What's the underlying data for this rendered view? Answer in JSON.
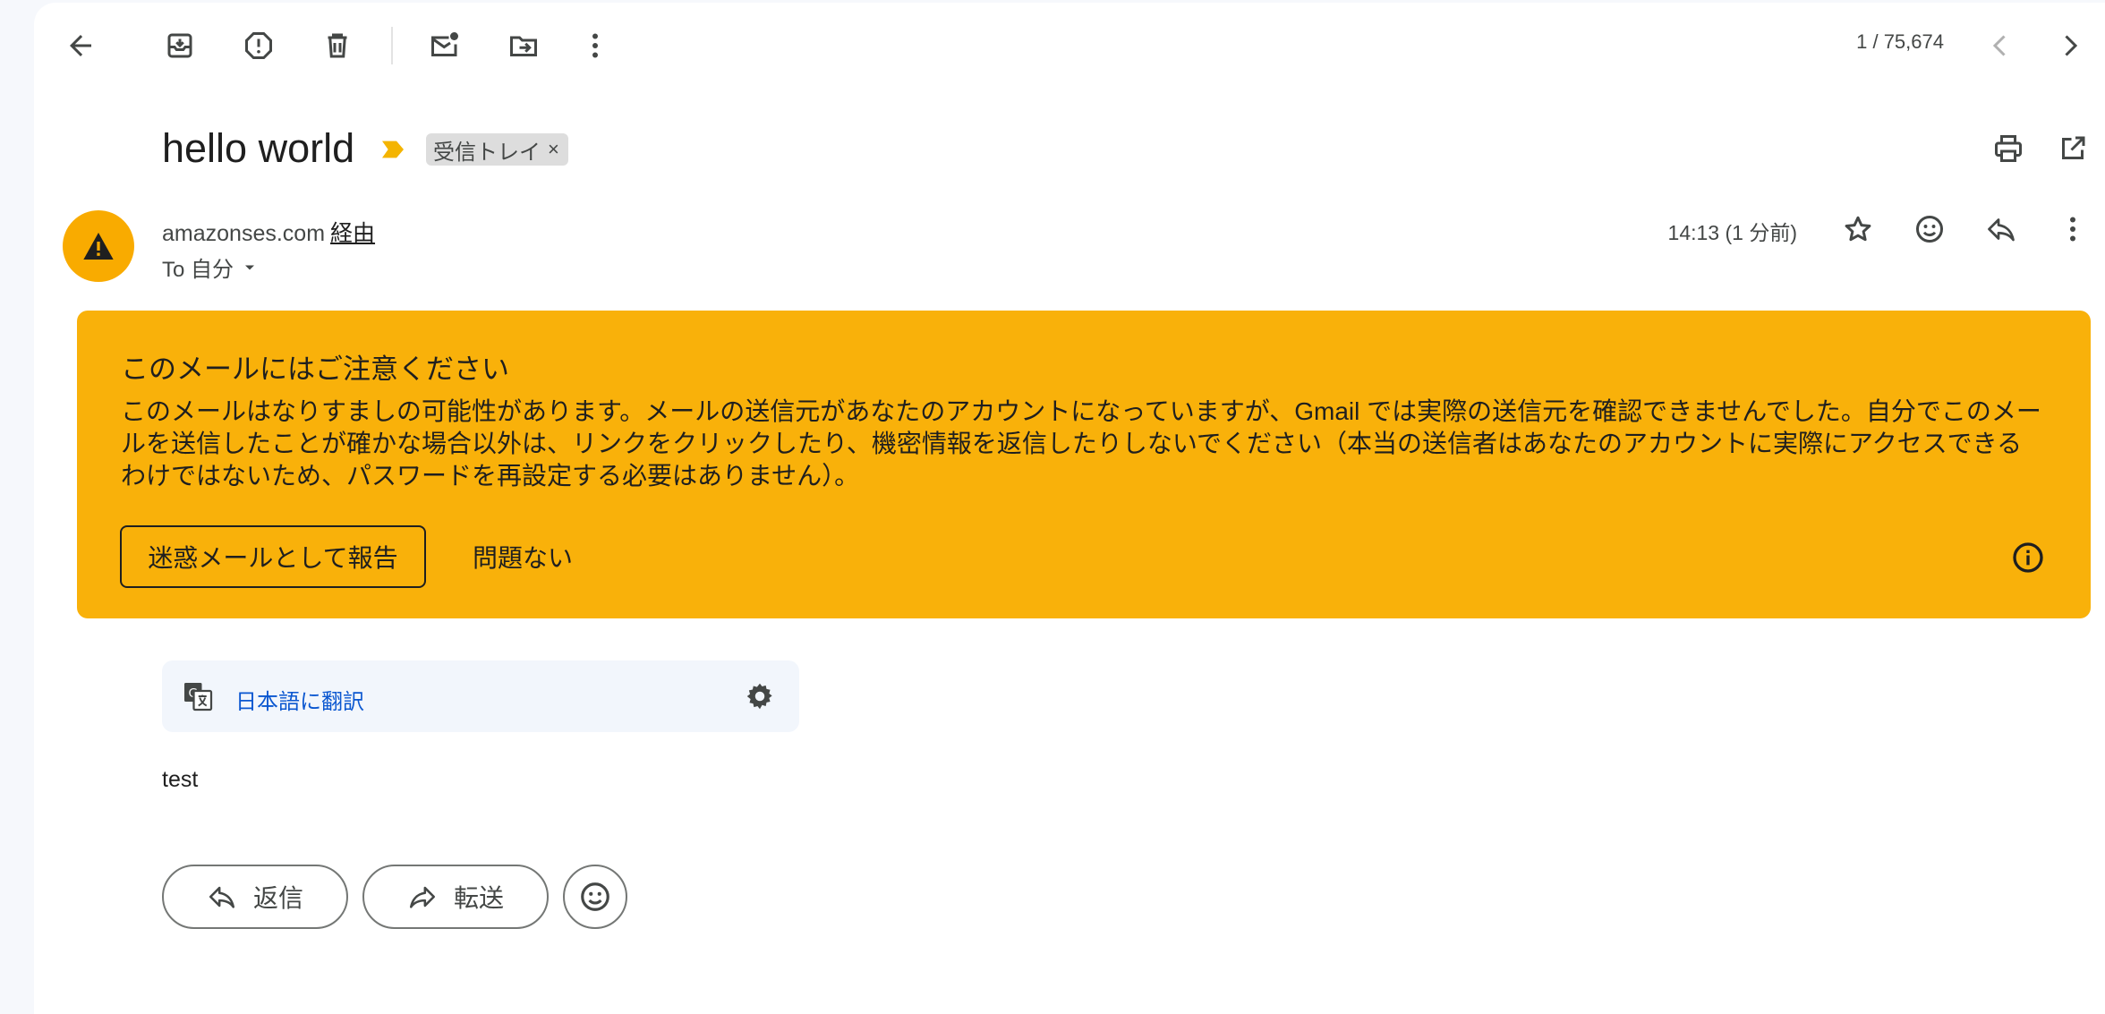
{
  "toolbar": {
    "counter": "1 / 75,674",
    "icons": [
      "back-arrow-icon",
      "archive-icon",
      "report-spam-icon",
      "delete-icon",
      "mark-unread-icon",
      "move-to-icon",
      "more-vert-icon",
      "prev-icon",
      "next-icon"
    ]
  },
  "message": {
    "subject": "hello world",
    "label": "受信トレイ",
    "label_close": "×",
    "sender": "amazonses.com",
    "via": "経由",
    "recipient": "To 自分",
    "time": "14:13 (1 分前)",
    "body": "test"
  },
  "warning": {
    "title": "このメールにはご注意ください",
    "text": "このメールはなりすましの可能性があります。メールの送信元があなたのアカウントになっていますが、Gmail では実際の送信元を確認できませんでした。自分でこのメールを送信したことが確かな場合以外は、リンクをクリックしたり、機密情報を返信したりしないでください（本当の送信者はあなたのアカウントに実際にアクセスできるわけではないため、パスワードを再設定する必要はありません）。",
    "report_button": "迷惑メールとして報告",
    "ok_button": "問題ない",
    "bg_color": "#f9b10a"
  },
  "translate": {
    "link": "日本語に翻訳"
  },
  "actions": {
    "reply": "返信",
    "forward": "転送"
  }
}
